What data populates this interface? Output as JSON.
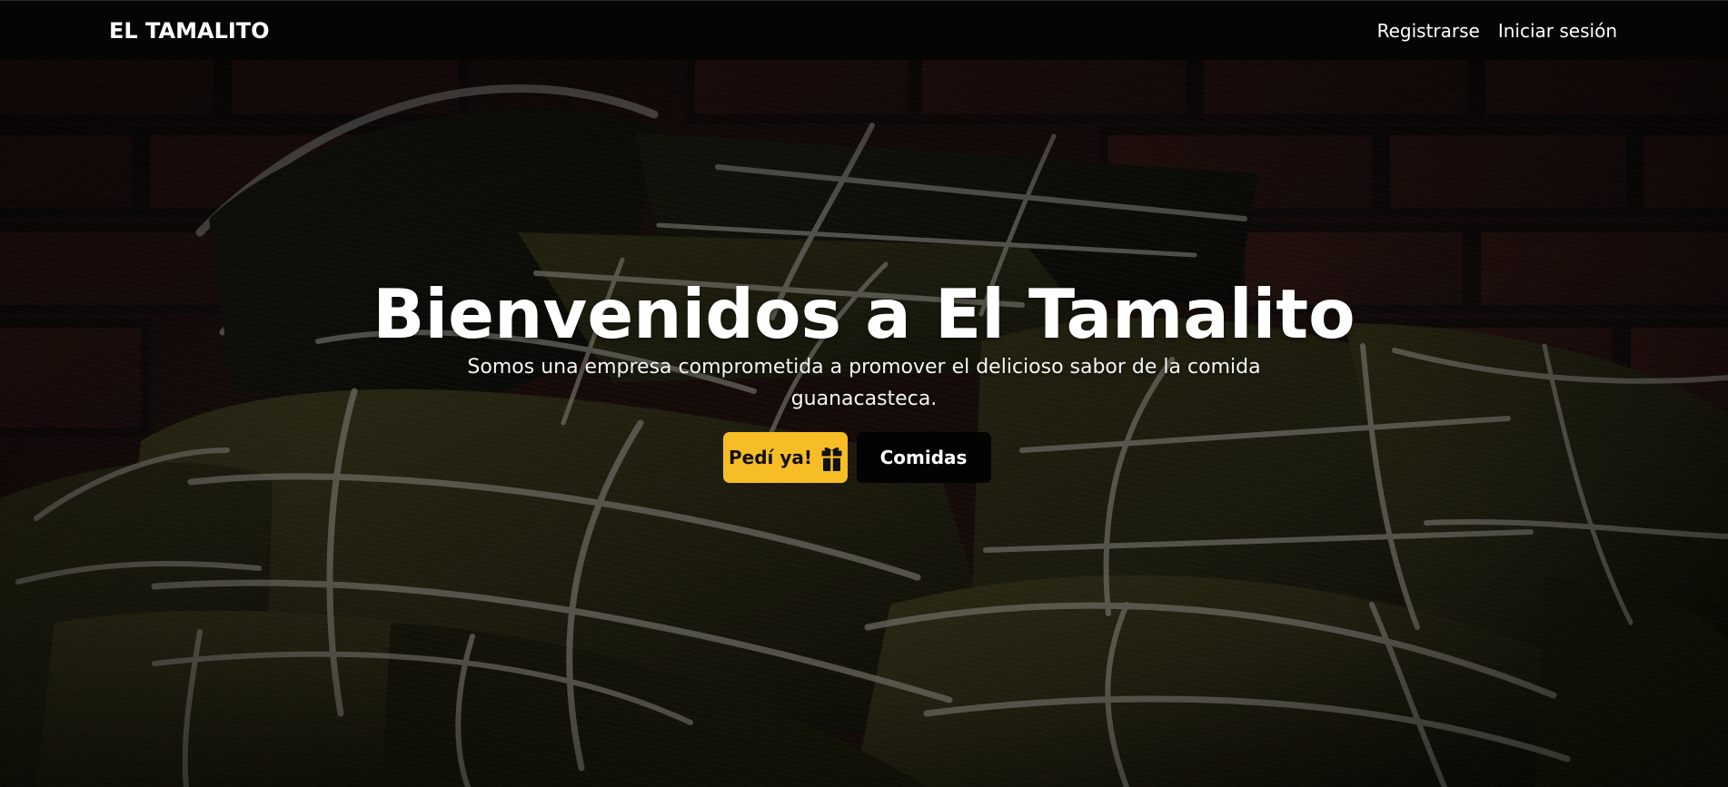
{
  "header": {
    "brand": "EL TAMALITO",
    "links": [
      "Registrarse",
      "Iniciar sesión"
    ]
  },
  "hero": {
    "title": "Bienvenidos a El Tamalito",
    "description": "Somos una empresa comprometida a promover el delicioso sabor de la comida guanacasteca.",
    "buttons": {
      "order": "Pedí ya!",
      "foods": "Comidas"
    },
    "icons": {
      "order": "gift-icon"
    }
  },
  "colors": {
    "navbar": "#050505",
    "accent": "#f6bd26",
    "dark_button": "#030303",
    "text": "#ffffff"
  }
}
